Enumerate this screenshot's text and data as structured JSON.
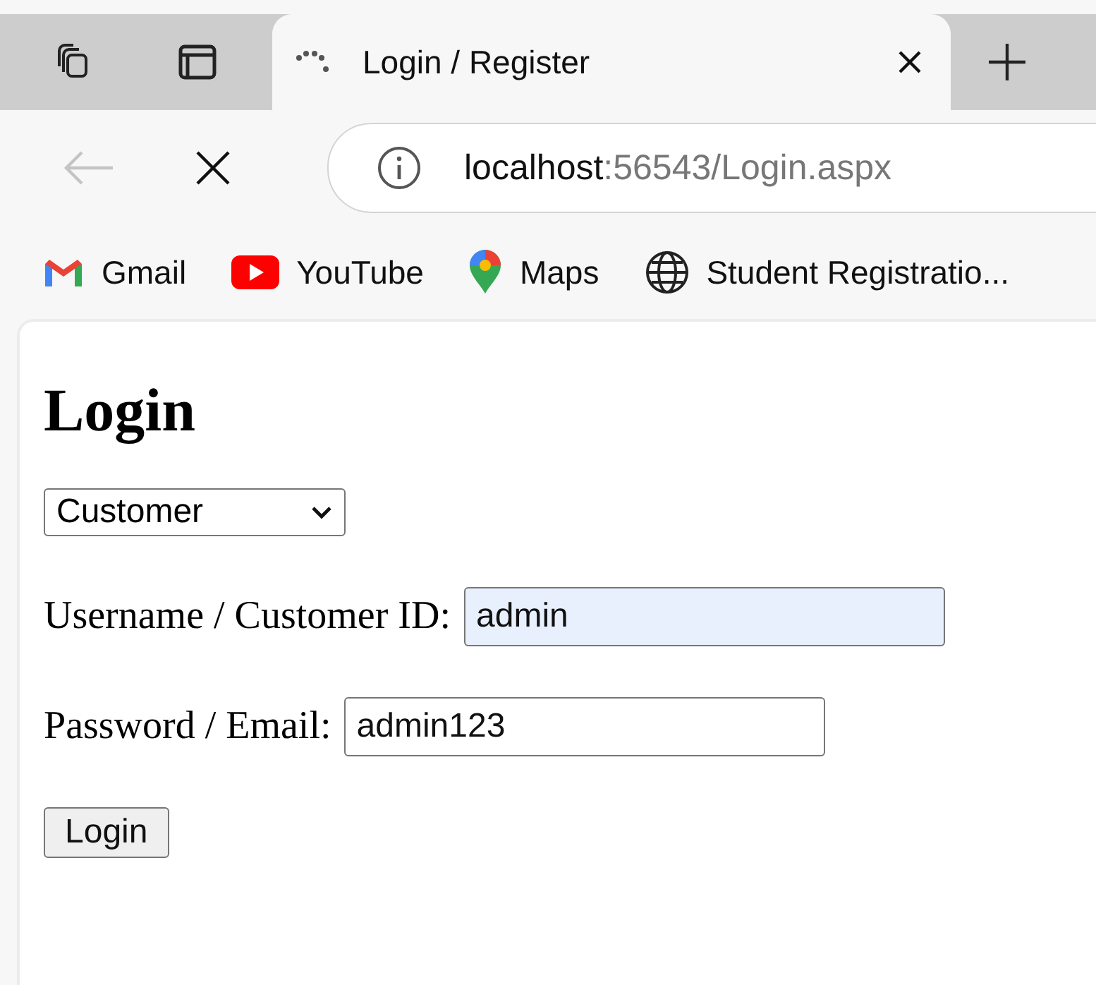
{
  "tabs": [
    {
      "title": "Login / Register",
      "selected": true
    }
  ],
  "address_bar": {
    "host": "localhost",
    "path": ":56543/Login.aspx"
  },
  "bookmarks": [
    {
      "kind": "gmail",
      "label": "Gmail"
    },
    {
      "kind": "youtube",
      "label": "YouTube"
    },
    {
      "kind": "maps",
      "label": "Maps"
    },
    {
      "kind": "globe",
      "label": "Student Registratio..."
    }
  ],
  "page": {
    "heading": "Login",
    "role_select": {
      "value": "Customer"
    },
    "fields": [
      {
        "label": "Username / Customer ID:",
        "value": "admin",
        "autofilled": true,
        "kind": "text"
      },
      {
        "label": "Password / Email:",
        "value": "admin123",
        "autofilled": false,
        "kind": "text"
      }
    ],
    "submit_button": "Login"
  }
}
